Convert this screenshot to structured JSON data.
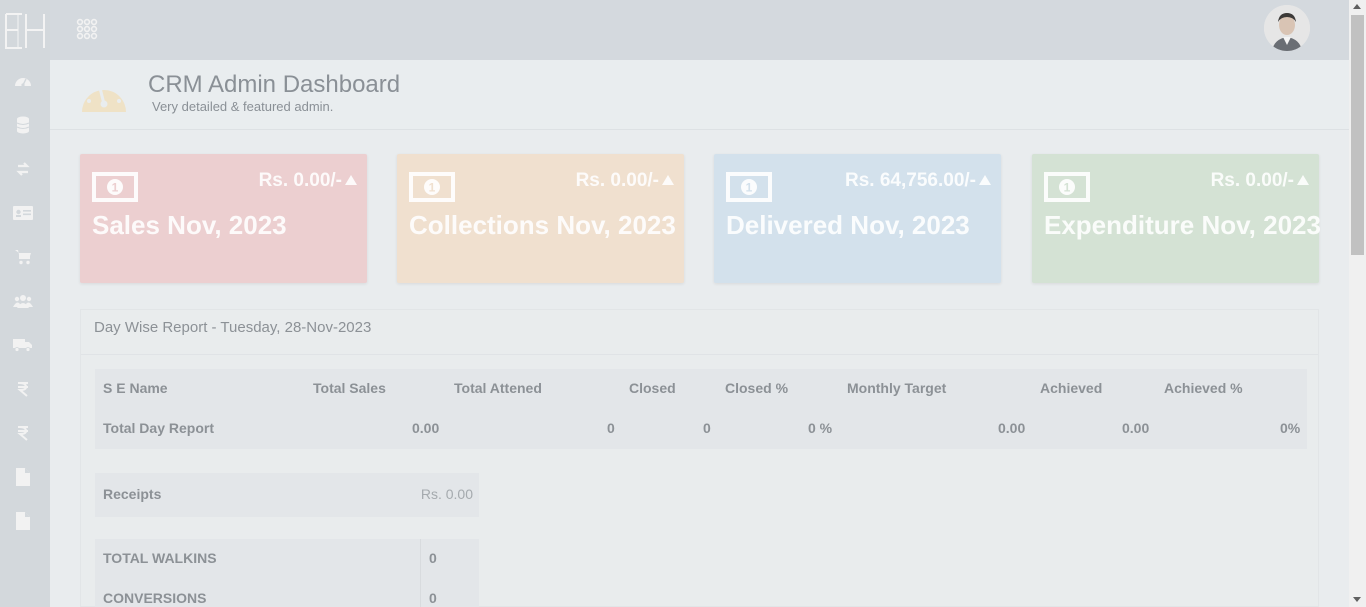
{
  "header": {
    "title": "CRM Admin Dashboard",
    "subtitle": "Very detailed & featured admin."
  },
  "sidebar": {
    "items": [
      {
        "icon": "dashboard-icon"
      },
      {
        "icon": "database-icon"
      },
      {
        "icon": "exchange-icon"
      },
      {
        "icon": "id-card-icon"
      },
      {
        "icon": "cart-icon"
      },
      {
        "icon": "users-icon"
      },
      {
        "icon": "truck-icon"
      },
      {
        "icon": "rupee-icon"
      },
      {
        "icon": "rupee-icon"
      },
      {
        "icon": "file-icon"
      },
      {
        "icon": "file-icon"
      }
    ]
  },
  "cards": [
    {
      "amount": "Rs. 0.00/-",
      "label": "Sales Nov, 2023",
      "color": "#eccfd0"
    },
    {
      "amount": "Rs. 0.00/-",
      "label": "Collections Nov, 2023",
      "color": "#f0e0cf"
    },
    {
      "amount": "Rs. 64,756.00/-",
      "label": "Delivered Nov, 2023",
      "color": "#d3e1ec"
    },
    {
      "amount": "Rs. 0.00/-",
      "label": "Expenditure Nov, 2023",
      "color": "#d4e2d4"
    }
  ],
  "report": {
    "title": "Day Wise Report - Tuesday, 28-Nov-2023",
    "columns": [
      "S E Name",
      "Total Sales",
      "Total Attened",
      "Closed",
      "Closed %",
      "Monthly Target",
      "Achieved",
      "Achieved %"
    ],
    "total_row": {
      "name": "Total Day Report",
      "total_sales": "0.00",
      "total_attended": "0",
      "closed": "0",
      "closed_pct": "0 %",
      "monthly_target": "0.00",
      "achieved": "0.00",
      "achieved_pct": "0%"
    }
  },
  "receipts": {
    "label": "Receipts",
    "value": "Rs. 0.00"
  },
  "walkins": [
    {
      "label": "TOTAL WALKINS",
      "value": "0"
    },
    {
      "label": "CONVERSIONS",
      "value": "0"
    }
  ]
}
